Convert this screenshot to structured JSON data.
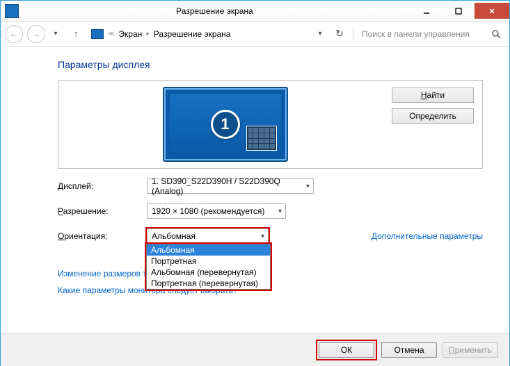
{
  "window": {
    "title": "Разрешение экрана"
  },
  "navbar": {
    "crumb_screen": "Экран",
    "crumb_resolution": "Разрешение экрана",
    "search_placeholder": "Поиск в панели управления"
  },
  "main": {
    "heading": "Параметры дисплея",
    "find_button": "Найти",
    "detect_button": "Определить",
    "monitor_number": "1",
    "display_label": "Дисплей:",
    "display_value": "1. SD390_S22D390H / S22D390Q (Analog)",
    "resolution_label": "Разрешение:",
    "resolution_value": "1920 × 1080 (рекомендуется)",
    "orientation_label": "Ориентация:",
    "orientation_value": "Альбомная",
    "orientation_options": {
      "opt0": "Альбомная",
      "opt1": "Портретная",
      "opt2": "Альбомная (перевернутая)",
      "opt3": "Портретная (перевернутая)"
    },
    "advanced_link": "Дополнительные параметры",
    "resize_link": "Изменение размеров те",
    "which_settings_link": "Какие параметры монитора следует выбрать?"
  },
  "buttons": {
    "ok": "ОК",
    "cancel": "Отмена",
    "apply": "Применить"
  }
}
